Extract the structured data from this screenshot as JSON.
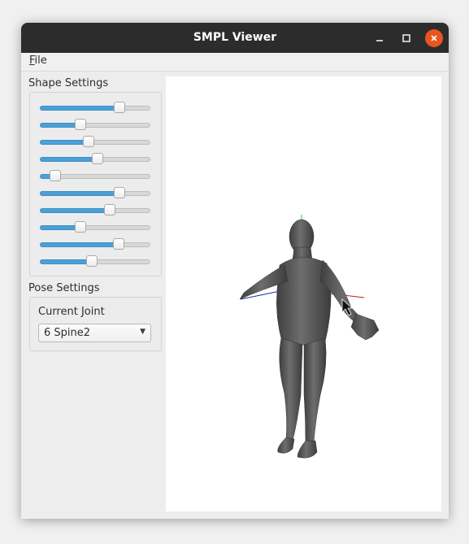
{
  "window": {
    "title": "SMPL Viewer"
  },
  "menubar": {
    "file_mnemonic": "F",
    "file_rest": "ile"
  },
  "shape_settings": {
    "label": "Shape Settings",
    "sliders": [
      0.72,
      0.37,
      0.44,
      0.52,
      0.14,
      0.72,
      0.63,
      0.37,
      0.71,
      0.47
    ]
  },
  "pose_settings": {
    "label": "Pose Settings",
    "current_joint_label": "Current Joint",
    "current_joint_value": "6 Spine2"
  },
  "colors": {
    "titlebar": "#2c2c2c",
    "close_button": "#e95420",
    "slider_fill": "#4aa0d8",
    "model": "#5a5a5a"
  },
  "icons": {
    "minimize": "minimize-icon",
    "maximize": "maximize-icon",
    "close": "close-icon",
    "dropdown": "chevron-down-icon"
  }
}
